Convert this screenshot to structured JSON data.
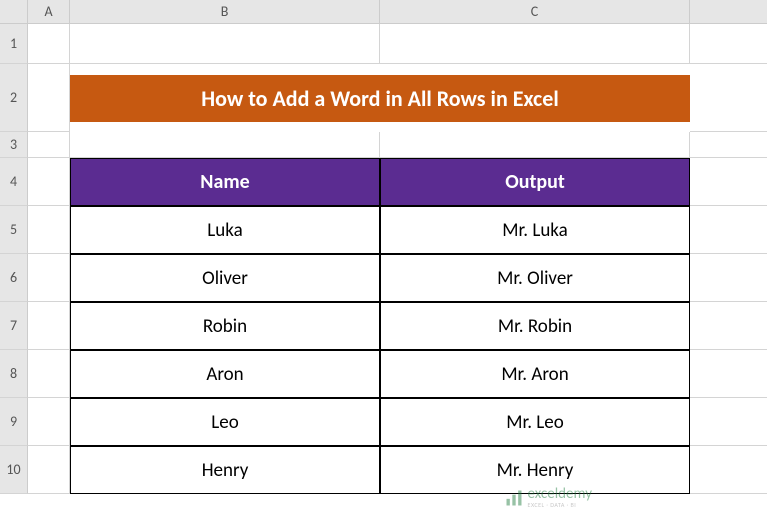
{
  "columns": [
    "A",
    "B",
    "C"
  ],
  "rows": [
    "1",
    "2",
    "3",
    "4",
    "5",
    "6",
    "7",
    "8",
    "9",
    "10"
  ],
  "title": "How to Add a Word in All Rows in Excel",
  "headers": {
    "name": "Name",
    "output": "Output"
  },
  "chart_data": {
    "type": "table",
    "title": "How to Add a Word in All Rows in Excel",
    "columns": [
      "Name",
      "Output"
    ],
    "rows": [
      [
        "Luka",
        "Mr. Luka"
      ],
      [
        "Oliver",
        "Mr. Oliver"
      ],
      [
        "Robin",
        "Mr. Robin"
      ],
      [
        "Aron",
        "Mr. Aron"
      ],
      [
        "Leo",
        "Mr. Leo"
      ],
      [
        "Henry",
        "Mr. Henry"
      ]
    ]
  },
  "watermark": {
    "brand": "exceldemy",
    "tagline": "EXCEL · DATA · BI"
  }
}
